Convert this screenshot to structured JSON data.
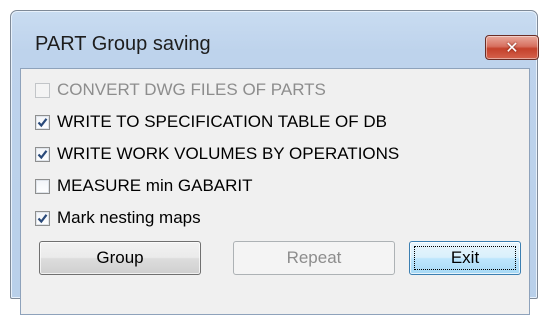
{
  "window": {
    "title": "PART Group saving",
    "close_label": "✕"
  },
  "options": [
    {
      "label": "CONVERT DWG FILES OF PARTS",
      "checked": false,
      "enabled": false
    },
    {
      "label": "WRITE TO SPECIFICATION TABLE OF DB",
      "checked": true,
      "enabled": true
    },
    {
      "label": "WRITE WORK VOLUMES BY OPERATIONS",
      "checked": true,
      "enabled": true
    },
    {
      "label": "MEASURE min GABARIT",
      "checked": false,
      "enabled": true
    },
    {
      "label": "Mark nesting maps",
      "checked": true,
      "enabled": true
    }
  ],
  "buttons": {
    "group_label": "Group",
    "repeat_label": "Repeat",
    "exit_label": "Exit"
  },
  "colors": {
    "checkmark": "#2a4a7a",
    "title_bar": "#bed3ec",
    "close_button": "#c4412b",
    "default_button": "#3c7fb1"
  }
}
